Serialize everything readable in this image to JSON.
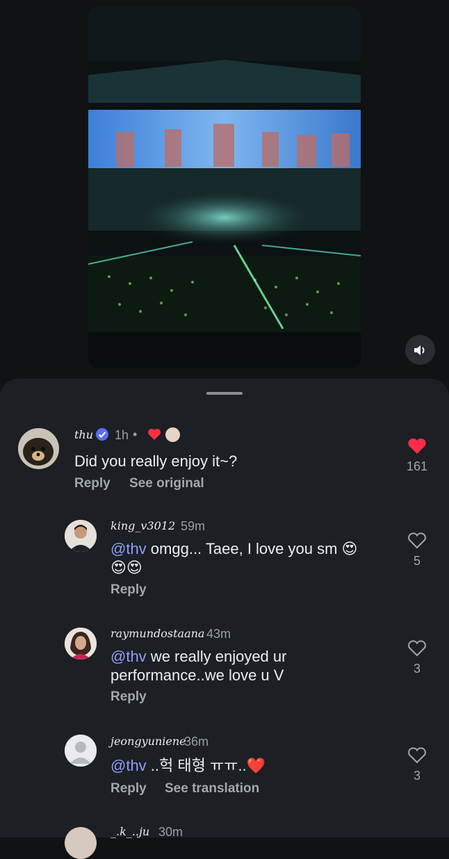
{
  "video": {
    "sound_icon": "speaker-icon"
  },
  "comments": [
    {
      "username": "thu",
      "verified": true,
      "time": "1h",
      "dot": "•",
      "text": "Did you really enjoy it~?",
      "reply_label": "Reply",
      "secondary_action": "See original",
      "likes": "161",
      "liked": true
    },
    {
      "username": "king_v3012",
      "time": "59m",
      "mention": "@thv",
      "text_line1": " omgg... Taee, I love you sm 😍",
      "text_line2": "😍😍",
      "reply_label": "Reply",
      "likes": "5",
      "liked": false
    },
    {
      "username": "raymundostaana",
      "time": "43m",
      "mention": "@thv",
      "text_line1": "  we really enjoyed ur",
      "text_line2": "performance..we love u V",
      "reply_label": "Reply",
      "likes": "3",
      "liked": false
    },
    {
      "username": "jeongyuniene",
      "time": "36m",
      "mention": "@thv",
      "text_line1": " ..헉 태형 ㅠㅠ..❤️",
      "reply_label": "Reply",
      "secondary_action": "See translation",
      "likes": "3",
      "liked": false
    },
    {
      "username": "_.k_..ju",
      "time": "30m"
    }
  ],
  "colors": {
    "accent_heart": "#ff2d45",
    "mention": "#8f9dff",
    "sheet_bg": "#1c1f23",
    "verified": "#5b6cff"
  }
}
